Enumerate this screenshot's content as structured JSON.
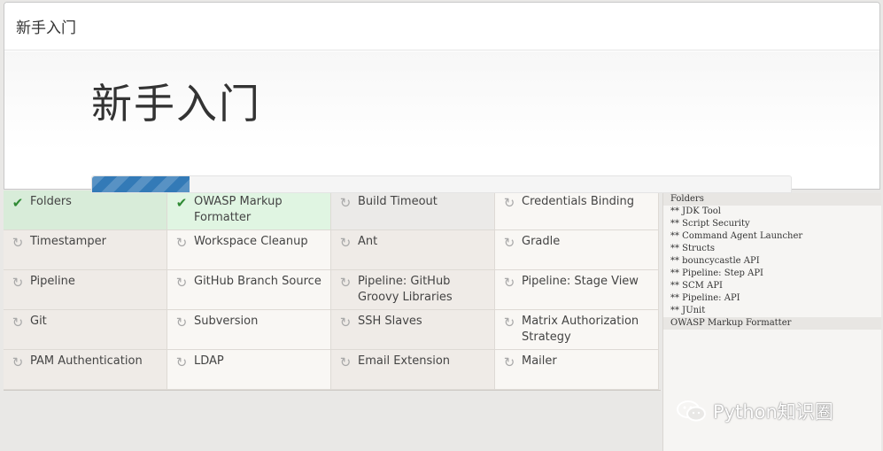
{
  "dialog": {
    "header_title": "新手入门",
    "hero_title": "新手入门"
  },
  "progress": {
    "value_percent": 14
  },
  "plugins": [
    {
      "name": "Folders",
      "status": "done",
      "icon": "check-icon"
    },
    {
      "name": "OWASP Markup Formatter",
      "status": "done",
      "icon": "check-icon"
    },
    {
      "name": "Build Timeout",
      "status": "installing",
      "icon": "refresh-icon"
    },
    {
      "name": "Credentials Binding",
      "status": "pending",
      "icon": "refresh-icon"
    },
    {
      "name": "Timestamper",
      "status": "pending",
      "icon": "refresh-icon"
    },
    {
      "name": "Workspace Cleanup",
      "status": "pending",
      "icon": "refresh-icon"
    },
    {
      "name": "Ant",
      "status": "pending",
      "icon": "refresh-icon"
    },
    {
      "name": "Gradle",
      "status": "pending",
      "icon": "refresh-icon"
    },
    {
      "name": "Pipeline",
      "status": "pending",
      "icon": "refresh-icon"
    },
    {
      "name": "GitHub Branch Source",
      "status": "pending",
      "icon": "refresh-icon"
    },
    {
      "name": "Pipeline: GitHub Groovy Libraries",
      "status": "pending",
      "icon": "refresh-icon"
    },
    {
      "name": "Pipeline: Stage View",
      "status": "pending",
      "icon": "refresh-icon"
    },
    {
      "name": "Git",
      "status": "pending",
      "icon": "refresh-icon"
    },
    {
      "name": "Subversion",
      "status": "pending",
      "icon": "refresh-icon"
    },
    {
      "name": "SSH Slaves",
      "status": "pending",
      "icon": "refresh-icon"
    },
    {
      "name": "Matrix Authorization Strategy",
      "status": "pending",
      "icon": "refresh-icon"
    },
    {
      "name": "PAM Authentication",
      "status": "pending",
      "icon": "refresh-icon"
    },
    {
      "name": "LDAP",
      "status": "pending",
      "icon": "refresh-icon"
    },
    {
      "name": "Email Extension",
      "status": "pending",
      "icon": "refresh-icon"
    },
    {
      "name": "Mailer",
      "status": "pending",
      "icon": "refresh-icon"
    }
  ],
  "log": {
    "lines": [
      "Folders",
      "** JDK Tool",
      "** Script Security",
      "** Command Agent Launcher",
      "** Structs",
      "** bouncycastle API",
      "** Pipeline: Step API",
      "** SCM API",
      "** Pipeline: API",
      "** JUnit",
      "OWASP Markup Formatter"
    ]
  },
  "watermark": {
    "text": "Python知识圈"
  },
  "colors": {
    "progress": "#337ab7",
    "check": "#2f8a34",
    "done_bg": "#d8ecd9"
  }
}
